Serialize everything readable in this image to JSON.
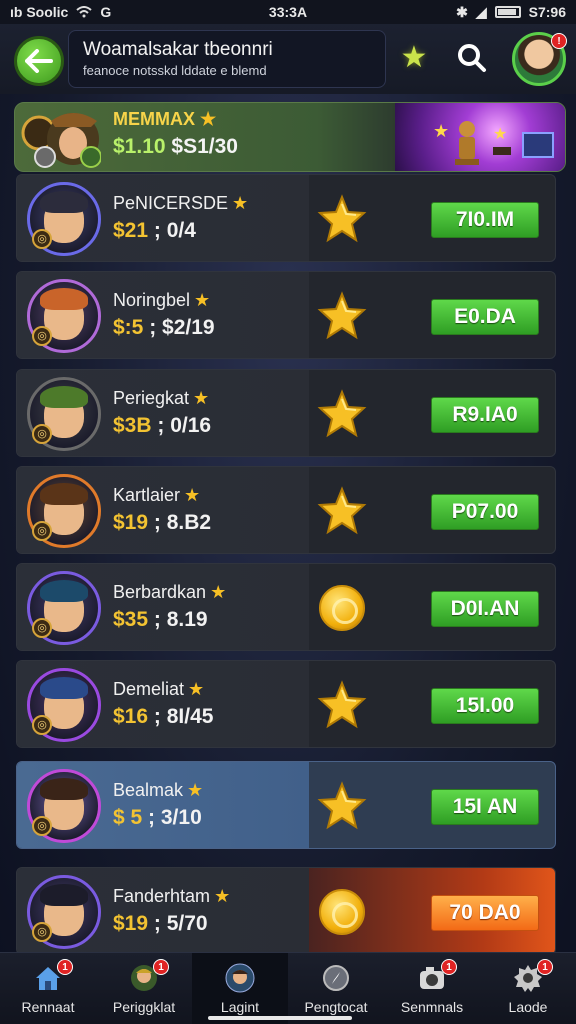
{
  "status_bar": {
    "carrier": "ıb Soolic",
    "time": "33:3A",
    "battery": "S7:96"
  },
  "header": {
    "title": "Woamalsakar tbeonnri",
    "subtitle": "feanoce notsskd lddate e blemd"
  },
  "banner": {
    "name": "MEMMAX",
    "value": "$1.10",
    "sub": "$S1/30"
  },
  "players": [
    {
      "name": "PeNICERSDE",
      "value": "$21",
      "sub": "0/4",
      "amount": "7I0.IM",
      "icon": "star",
      "hair": "#2c2c3c",
      "ring": "#6a6ae8"
    },
    {
      "name": "Noringbel",
      "value": "$:5",
      "sub": "$2/19",
      "amount": "E0.DA",
      "icon": "star",
      "hair": "#c9642a",
      "ring": "#b06ad8"
    },
    {
      "name": "Periegkat",
      "value": "$3B",
      "sub": "0/16",
      "amount": "R9.IA0",
      "icon": "star",
      "hair": "#4d7a2a",
      "ring": "#6a6a6a"
    },
    {
      "name": "Kartlaier",
      "value": "$19",
      "sub": "8.B2",
      "amount": "P07.00",
      "icon": "star",
      "hair": "#5a3418",
      "ring": "#e07a2a"
    },
    {
      "name": "Berbardkan",
      "value": "$35",
      "sub": "8.19",
      "amount": "D0I.AN",
      "icon": "coin",
      "hair": "#1c4a6a",
      "ring": "#7a5be0"
    },
    {
      "name": "Demeliat",
      "value": "$16",
      "sub": "8I/45",
      "amount": "15I.00",
      "icon": "star",
      "hair": "#2a4a8a",
      "ring": "#9a4ae0"
    },
    {
      "name": "Bealmak",
      "value": "$ 5",
      "sub": "3/10",
      "amount": "15I AN",
      "icon": "star",
      "hair": "#3a2418",
      "ring": "#c04ad8"
    },
    {
      "name": "Fanderhtam",
      "value": "$19",
      "sub": "5/70",
      "amount": "70 DA0",
      "icon": "coin",
      "hair": "#1c1c2a",
      "ring": "#7a5be0"
    }
  ],
  "bottom_nav": [
    {
      "label": "Rennaat",
      "icon": "home-icon",
      "badge": "1"
    },
    {
      "label": "Periggklat",
      "icon": "profile-icon",
      "badge": "1"
    },
    {
      "label": "Lagint",
      "icon": "avatar-icon",
      "badge": ""
    },
    {
      "label": "Pengtocat",
      "icon": "compass-icon",
      "badge": ""
    },
    {
      "label": "Senmnals",
      "icon": "camera-icon",
      "badge": "1"
    },
    {
      "label": "Laode",
      "icon": "gear-icon",
      "badge": "1"
    }
  ],
  "colors": {
    "accent_green": "#3fb52a",
    "gold": "#f3c332",
    "orange": "#f36a16"
  }
}
